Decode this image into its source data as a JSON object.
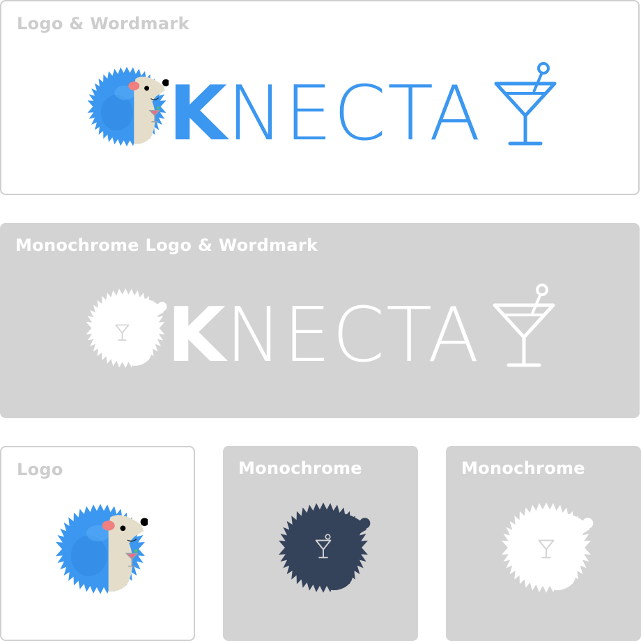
{
  "colors": {
    "brand_blue": "#3b97f0",
    "hedgehog_face": "#e4ddc9",
    "navy": "#34425a",
    "panel_gray": "#d3d3d3",
    "white": "#ffffff",
    "light_title": "#cdcdcd"
  },
  "panels": {
    "logo_wordmark": {
      "title": "Logo & Wordmark"
    },
    "mono_logo_wordmark": {
      "title": "Monochrome Logo & Wordmark"
    },
    "logo": {
      "title": "Logo"
    },
    "mono_dark": {
      "title": "Monochrome"
    },
    "mono_white": {
      "title": "Monochrome"
    }
  },
  "wordmark": {
    "first_letter": "K",
    "rest": "NECTA"
  },
  "icons": [
    "hedgehog-icon",
    "martini-glass-icon"
  ]
}
